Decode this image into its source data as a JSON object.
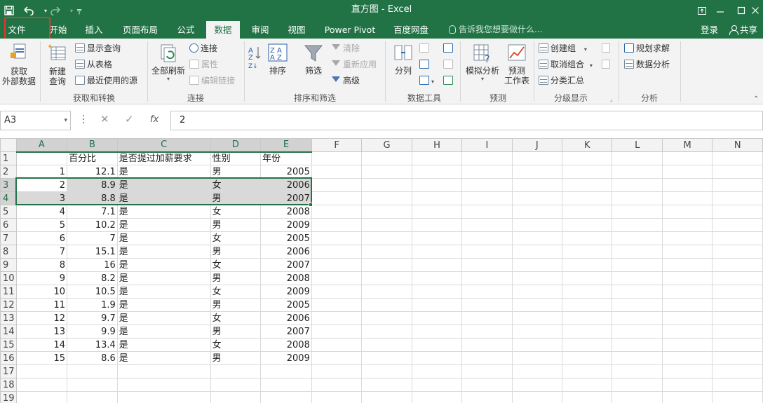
{
  "titlebar": {
    "title": "直方图 - Excel",
    "save_icon": "save-icon",
    "undo_icon": "undo-icon",
    "redo_icon": "redo-icon",
    "customize_icon": "customize-qat-icon",
    "ribbon_display_icon": "ribbon-display-options-icon",
    "minimize_icon": "minimize-icon",
    "restore_icon": "restore-icon",
    "close_icon": "close-icon"
  },
  "tabs": {
    "items": [
      "文件",
      "开始",
      "插入",
      "页面布局",
      "公式",
      "数据",
      "审阅",
      "视图",
      "Power Pivot",
      "百度网盘"
    ],
    "active": "数据",
    "tell_me": "告诉我您想要做什么...",
    "login": "登录",
    "share": "共享"
  },
  "ribbon": {
    "get_external": "获取\n外部数据",
    "new_query": "新建\n查询",
    "show_queries": "显示查询",
    "from_table": "从表格",
    "recent_sources": "最近使用的源",
    "group_get_transform": "获取和转换",
    "refresh_all": "全部刷新",
    "connections": "连接",
    "properties": "属性",
    "edit_links": "编辑链接",
    "group_connections": "连接",
    "sort": "排序",
    "filter": "筛选",
    "clear": "清除",
    "reapply": "重新应用",
    "advanced": "高级",
    "group_sort_filter": "排序和筛选",
    "text_to_columns": "分列",
    "group_data_tools": "数据工具",
    "what_if": "模拟分析",
    "forecast_sheet": "预测\n工作表",
    "group_forecast": "预测",
    "group": "创建组",
    "ungroup": "取消组合",
    "subtotal": "分类汇总",
    "group_outline": "分级显示",
    "solver": "规划求解",
    "data_analysis": "数据分析",
    "group_analysis": "分析"
  },
  "formula_bar": {
    "name_box": "A3",
    "cancel": "✕",
    "enter": "✓",
    "fx": "fx",
    "value": "2"
  },
  "sheet": {
    "columns": [
      "A",
      "B",
      "C",
      "D",
      "E",
      "F",
      "G",
      "H",
      "I",
      "J",
      "K",
      "L",
      "M",
      "N"
    ],
    "row_numbers": [
      "1",
      "2",
      "3",
      "4",
      "5",
      "6",
      "7",
      "8",
      "9",
      "10",
      "11",
      "12",
      "13",
      "14",
      "15",
      "16",
      "17",
      "18",
      "19"
    ],
    "header_row": [
      "",
      "百分比",
      "是否提过加薪要求",
      "性别",
      "年份"
    ],
    "rows": [
      [
        "1",
        "12.1",
        "是",
        "男",
        "2005"
      ],
      [
        "2",
        "8.9",
        "是",
        "女",
        "2006"
      ],
      [
        "3",
        "8.8",
        "是",
        "男",
        "2007"
      ],
      [
        "4",
        "7.1",
        "是",
        "女",
        "2008"
      ],
      [
        "5",
        "10.2",
        "是",
        "男",
        "2009"
      ],
      [
        "6",
        "7",
        "是",
        "女",
        "2005"
      ],
      [
        "7",
        "15.1",
        "是",
        "男",
        "2006"
      ],
      [
        "8",
        "16",
        "是",
        "女",
        "2007"
      ],
      [
        "9",
        "8.2",
        "是",
        "男",
        "2008"
      ],
      [
        "10",
        "10.5",
        "是",
        "女",
        "2009"
      ],
      [
        "11",
        "1.9",
        "是",
        "男",
        "2005"
      ],
      [
        "12",
        "9.7",
        "是",
        "女",
        "2006"
      ],
      [
        "13",
        "9.9",
        "是",
        "男",
        "2007"
      ],
      [
        "14",
        "13.4",
        "是",
        "女",
        "2008"
      ],
      [
        "15",
        "8.6",
        "是",
        "男",
        "2009"
      ]
    ]
  }
}
